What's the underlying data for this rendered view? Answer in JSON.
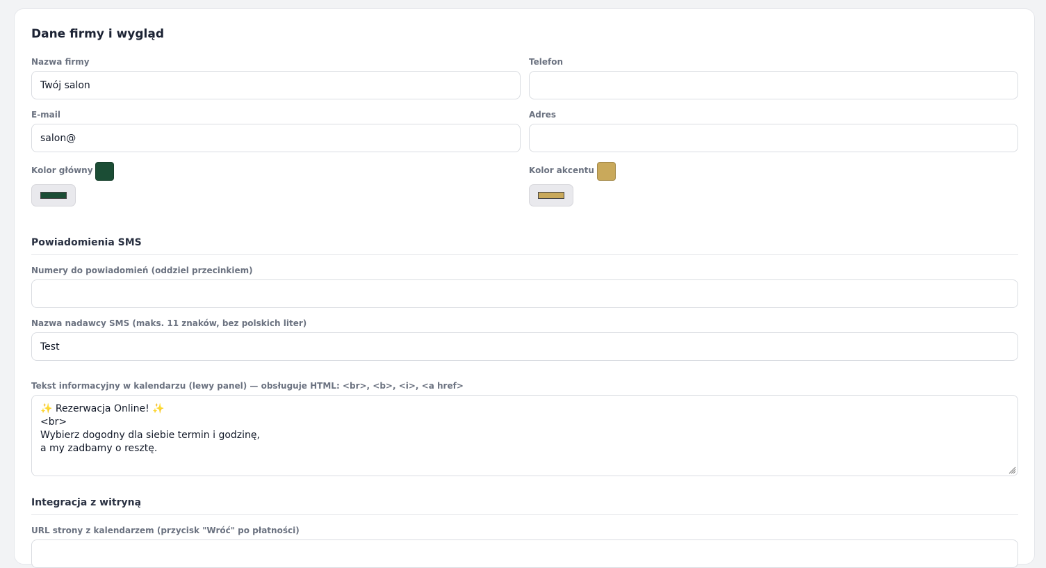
{
  "card_title": "Dane firmy i wygląd",
  "fields": {
    "company_name": {
      "label": "Nazwa firmy",
      "value": "Twój salon"
    },
    "phone": {
      "label": "Telefon",
      "value": ""
    },
    "email": {
      "label": "E-mail",
      "value": "salon@"
    },
    "address": {
      "label": "Adres",
      "value": ""
    }
  },
  "colors": {
    "primary": {
      "label": "Kolor główny",
      "value": "#1b4d35"
    },
    "accent": {
      "label": "Kolor akcentu",
      "value": "#c9a95b"
    }
  },
  "sms": {
    "title": "Powiadomienia SMS",
    "numbers": {
      "label": "Numery do powiadomień (oddziel przecinkiem)",
      "value": ""
    },
    "sender": {
      "label": "Nazwa nadawcy SMS (maks. 11 znaków, bez polskich liter)",
      "value": "Test"
    },
    "info_text": {
      "label": "Tekst informacyjny w kalendarzu (lewy panel) — obsługuje HTML: <br>, <b>, <i>, <a href>",
      "line1_icon": "sparkle-emoji",
      "line1_text": " Rezerwacja Online! ",
      "line2": "<br>",
      "line3": "Wybierz dogodny dla siebie termin i godzinę,",
      "line4": "a my zadbamy o resztę."
    }
  },
  "integration": {
    "title": "Integracja z witryną",
    "url": {
      "label": "URL strony z kalendarzem (przycisk \"Wróć\" po płatności)",
      "value": ""
    }
  }
}
